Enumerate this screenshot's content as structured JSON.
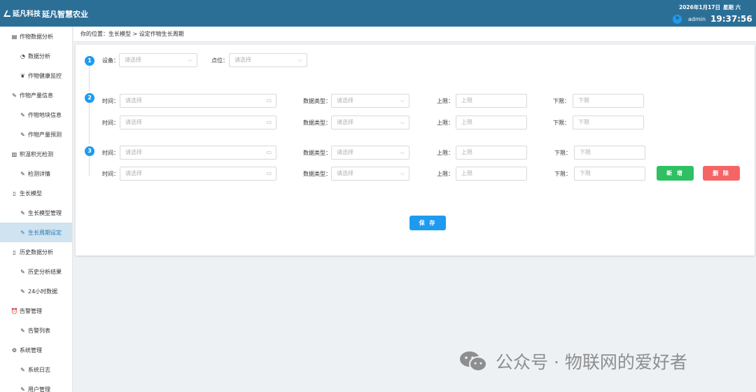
{
  "header": {
    "logo_text": "延凡科技",
    "app_title": "延凡智慧农业",
    "date": "2026年1月17日",
    "weekday": "星期 六",
    "username": "admin",
    "clock": "19:37:56"
  },
  "sidebar": {
    "items": [
      {
        "label": "作物数据分析",
        "icon": "chart-icon",
        "level": 1
      },
      {
        "label": "数据分析",
        "icon": "pie-icon",
        "level": 2
      },
      {
        "label": "作物健康监控",
        "icon": "leaf-icon",
        "level": 2
      },
      {
        "label": "作物产量信息",
        "icon": "edit-icon",
        "level": 1
      },
      {
        "label": "作物地块信息",
        "icon": "edit-icon",
        "level": 2
      },
      {
        "label": "作物产量预测",
        "icon": "edit-icon",
        "level": 2
      },
      {
        "label": "积温积光检测",
        "icon": "book-icon",
        "level": 1
      },
      {
        "label": "检测详情",
        "icon": "edit-icon",
        "level": 2
      },
      {
        "label": "生长模型",
        "icon": "file-icon",
        "level": 1
      },
      {
        "label": "生长模型管理",
        "icon": "edit-icon",
        "level": 2
      },
      {
        "label": "生长周期设定",
        "icon": "edit-icon",
        "level": 2,
        "active": true
      },
      {
        "label": "历史数据分析",
        "icon": "file-icon",
        "level": 1
      },
      {
        "label": "历史分析结果",
        "icon": "edit-icon",
        "level": 2
      },
      {
        "label": "24小时数据",
        "icon": "edit-icon",
        "level": 2
      },
      {
        "label": "告警管理",
        "icon": "alarm-icon",
        "level": 1
      },
      {
        "label": "告警列表",
        "icon": "edit-icon",
        "level": 2
      },
      {
        "label": "系统管理",
        "icon": "gear-icon",
        "level": 1
      },
      {
        "label": "系统日志",
        "icon": "edit-icon",
        "level": 2
      },
      {
        "label": "用户管理",
        "icon": "edit-icon",
        "level": 2
      }
    ]
  },
  "breadcrumb": "你的位置：生长模型 > 设定作物生长周期",
  "form": {
    "steps": [
      "1",
      "2",
      "3"
    ],
    "device_label": "设备：",
    "device_placeholder": "请选择",
    "point_label": "点位：",
    "point_placeholder": "请选择",
    "time_label": "时间：",
    "time_placeholder": "请选择",
    "dtype_label": "数据类型：",
    "dtype_placeholder": "请选择",
    "upper_label": "上限：",
    "upper_placeholder": "上限",
    "lower_label": "下限：",
    "lower_placeholder": "下限",
    "add_label": "新 增",
    "delete_label": "删 除",
    "save_label": "保 存"
  },
  "colors": {
    "header": "#2c6f96",
    "accent": "#1e9bf0",
    "add": "#2ec062",
    "delete": "#f56565",
    "active_bg": "#cfe3f1"
  },
  "watermark": "公众号 · 物联网的爱好者"
}
